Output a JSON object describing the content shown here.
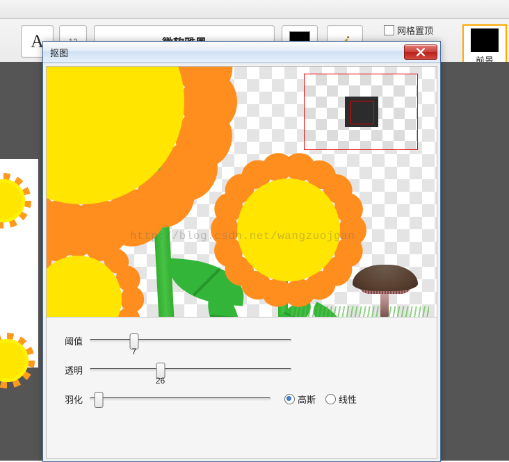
{
  "topbar": {
    "btn_a": "A",
    "btn_num": "12",
    "btn_wide": "微软雅黑",
    "grid_option_label": "网格置顶",
    "foreground_label": "前景"
  },
  "dialog": {
    "title": "抠图",
    "watermark": "http://blog.csdn.net/wangzuojgan"
  },
  "controls": {
    "threshold": {
      "label": "阈值",
      "value": "7",
      "percent": 22
    },
    "opacity": {
      "label": "透明",
      "value": "26",
      "percent": 35
    },
    "feather": {
      "label": "羽化",
      "value": "",
      "percent": 5
    },
    "algo": {
      "gaussian_label": "高斯",
      "linear_label": "线性",
      "selected": "gaussian"
    }
  }
}
